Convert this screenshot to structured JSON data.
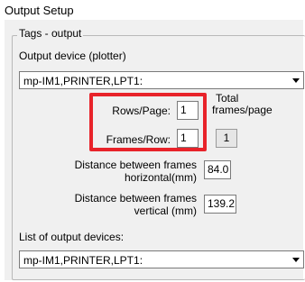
{
  "window": {
    "title": "Output Setup"
  },
  "group": {
    "legend": "Tags - output"
  },
  "output_device": {
    "label": "Output device (plotter)",
    "value": "mp-IM1,PRINTER,LPT1:"
  },
  "rows_per_page": {
    "label": "Rows/Page:",
    "value": "1"
  },
  "frames_per_row": {
    "label": "Frames/Row:",
    "value": "1"
  },
  "total_frames": {
    "label_line1": "Total",
    "label_line2": "frames/page",
    "value": "1"
  },
  "distance_horizontal": {
    "label_line1": "Distance between frames",
    "label_line2": "horizontal(mm)",
    "value": "84.0"
  },
  "distance_vertical": {
    "label_line1": "Distance between frames",
    "label_line2": "vertical (mm)",
    "value": "139.2"
  },
  "device_list": {
    "label": "List of output devices:",
    "value": "mp-IM1,PRINTER,LPT1:"
  },
  "colors": {
    "highlight": "#e8232a",
    "panel": "#f0f0f0"
  },
  "icons": {
    "dropdown": "chevron-down-icon"
  }
}
